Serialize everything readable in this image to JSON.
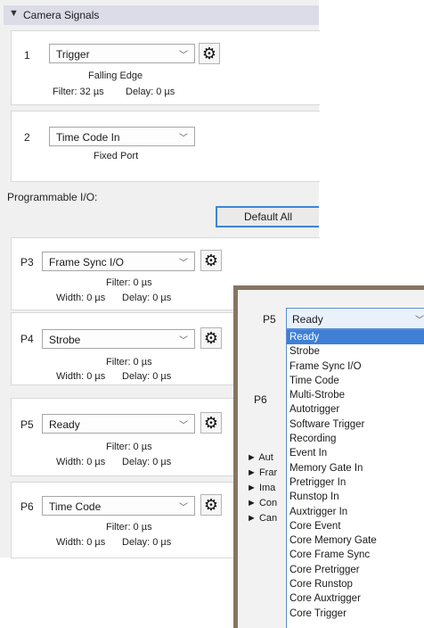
{
  "section": {
    "title": "Camera Signals",
    "collapse_icon": "triangle-down"
  },
  "signal1": {
    "number": "1",
    "value": "Trigger",
    "mode": "Falling Edge",
    "filter": "Filter: 32 µs",
    "delay": "Delay: 0 µs"
  },
  "signal2": {
    "number": "2",
    "value": "Time Code In",
    "mode": "Fixed Port"
  },
  "programmable": {
    "label": "Programmable I/O:",
    "default_all": "Default All"
  },
  "ports": [
    {
      "number": "P3",
      "value": "Frame Sync I/O",
      "filter": "Filter: 0 µs",
      "width": "Width: 0 µs",
      "delay": "Delay: 0 µs"
    },
    {
      "number": "P4",
      "value": "Strobe",
      "filter": "Filter: 0 µs",
      "width": "Width: 0 µs",
      "delay": "Delay: 0 µs"
    },
    {
      "number": "P5",
      "value": "Ready",
      "filter": "Filter: 0 µs",
      "width": "Width: 0 µs",
      "delay": "Delay: 0 µs"
    },
    {
      "number": "P6",
      "value": "Time Code",
      "filter": "Filter: 0 µs",
      "width": "Width: 0 µs",
      "delay": "Delay: 0 µs"
    }
  ],
  "popup": {
    "port_label": "P5",
    "selected": "Ready",
    "other_port_label": "P6",
    "tree_items": [
      "Aut",
      "Frar",
      "Ima",
      "Con",
      "Can"
    ],
    "options": [
      "Ready",
      "Strobe",
      "Frame Sync I/O",
      "Time Code",
      "Multi-Strobe",
      "Autotrigger",
      "Software Trigger",
      "Recording",
      "Event In",
      "Memory Gate In",
      "Pretrigger In",
      "Runstop In",
      "Auxtrigger In",
      "Core Event",
      "Core Memory Gate",
      "Core Frame Sync",
      "Core Pretrigger",
      "Core Runstop",
      "Core Auxtrigger",
      "Core Trigger"
    ]
  },
  "colors": {
    "accent": "#3f7fd6",
    "header_bg": "#dcdce8",
    "frame": "#867561"
  }
}
